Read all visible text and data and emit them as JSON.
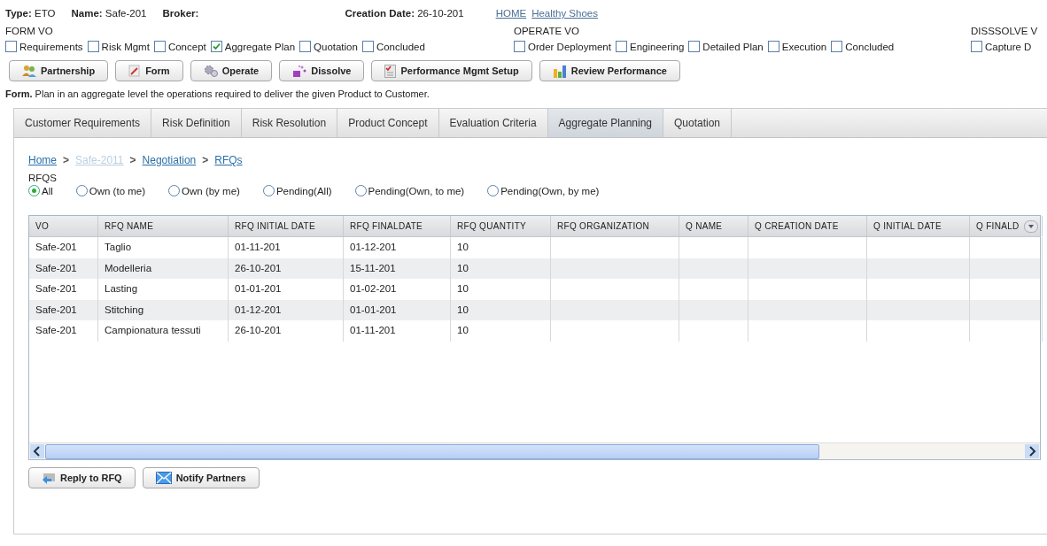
{
  "header": {
    "fields": [
      {
        "label": "Type:",
        "value": "ETO"
      },
      {
        "label": "Name:",
        "value": "Safe-201"
      },
      {
        "label": "Broker:"
      },
      {
        "label": "Creation Date:",
        "value": "26-10-201"
      }
    ],
    "links": [
      "HOME",
      "Healthy Shoes"
    ]
  },
  "phases": [
    {
      "title": "FORM VO",
      "items": [
        {
          "label": "Requirements",
          "checked": false
        },
        {
          "label": "Risk Mgmt",
          "checked": false
        },
        {
          "label": "Concept",
          "checked": false
        },
        {
          "label": "Aggregate Plan",
          "checked": true
        },
        {
          "label": "Quotation",
          "checked": false
        },
        {
          "label": "Concluded",
          "checked": false
        }
      ]
    },
    {
      "title": "OPERATE VO",
      "items": [
        {
          "label": "Order Deployment",
          "checked": false
        },
        {
          "label": "Engineering",
          "checked": false
        },
        {
          "label": "Detailed Plan",
          "checked": false
        },
        {
          "label": "Execution",
          "checked": false
        },
        {
          "label": "Concluded",
          "checked": false
        }
      ]
    },
    {
      "title": "DISSSOLVE V",
      "items": [
        {
          "label": "Capture D",
          "checked": false
        }
      ]
    }
  ],
  "toolbar": [
    {
      "label": "Partnership",
      "kind": "people"
    },
    {
      "label": "Form",
      "kind": "pencil"
    },
    {
      "label": "Operate",
      "kind": "gears"
    },
    {
      "label": "Dissolve",
      "kind": "sparkle"
    },
    {
      "label": "Performance Mgmt Setup",
      "kind": "checklist"
    },
    {
      "label": "Review Performance",
      "kind": "chart"
    }
  ],
  "description": "**Form.** Plan in an aggregate level the operations required to deliver the given Product to Customer.",
  "tabs": [
    {
      "label": "Customer Requirements",
      "selected": false
    },
    {
      "label": "Risk Definition",
      "selected": false
    },
    {
      "label": "Risk Resolution",
      "selected": false
    },
    {
      "label": "Product Concept",
      "selected": false
    },
    {
      "label": "Evaluation Criteria",
      "selected": false
    },
    {
      "label": "Aggregate Planning",
      "selected": true
    },
    {
      "label": "Quotation",
      "selected": false
    }
  ],
  "breadcrumb": [
    {
      "label": "Home",
      "disabled": false
    },
    {
      "separator": ">",
      "label": "Safe-2011",
      "disabled": true
    },
    {
      "separator": ">",
      "label": "Negotiation",
      "disabled": false
    },
    {
      "separator": ">",
      "label": "RFQs",
      "disabled": false
    }
  ],
  "filter": {
    "title": "RFQS",
    "options": [
      {
        "label": "All",
        "selected": true
      },
      {
        "label": "Own (to me)",
        "selected": false
      },
      {
        "label": "Own (by me)",
        "selected": false
      },
      {
        "label": "Pending(All)",
        "selected": false
      },
      {
        "label": "Pending(Own, to me)",
        "selected": false
      },
      {
        "label": "Pending(Own, by me)",
        "selected": false
      }
    ]
  },
  "table": {
    "columns": [
      "VO",
      "RFQ NAME",
      "RFQ INITIAL DATE",
      "RFQ FINALDATE",
      "RFQ QUANTITY",
      "RFQ ORGANIZATION",
      "Q NAME",
      "Q CREATION DATE",
      "Q INITIAL DATE",
      "Q FINALD"
    ],
    "rows": [
      [
        "Safe-201",
        "Taglio",
        "01-11-201",
        "01-12-201",
        "10"
      ],
      [
        "Safe-201",
        "Modelleria",
        "26-10-201",
        "15-11-201",
        "10"
      ],
      [
        "Safe-201",
        "Lasting",
        "01-01-201",
        "01-02-201",
        "10"
      ],
      [
        "Safe-201",
        "Stitching",
        "01-12-201",
        "01-01-201",
        "10"
      ],
      [
        "Safe-201",
        "Campionatura tessuti",
        "26-10-201",
        "01-11-201",
        "10"
      ]
    ]
  },
  "actions": [
    {
      "label": "Reply to RFQ",
      "kind": "reply"
    },
    {
      "label": "Notify Partners",
      "kind": "mail"
    }
  ]
}
